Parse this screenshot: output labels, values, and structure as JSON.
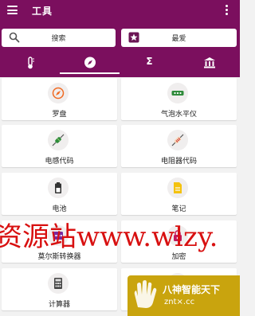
{
  "app": {
    "title": "工具"
  },
  "actions": {
    "search_label": "搜索",
    "favorites_label": "最爱"
  },
  "tabs": [
    {
      "name": "measure",
      "icon": "thermometer-icon",
      "selected": false
    },
    {
      "name": "compass",
      "icon": "compass-icon",
      "selected": true
    },
    {
      "name": "math",
      "icon": "sigma-icon",
      "selected": false,
      "glyph": "Σ"
    },
    {
      "name": "finance",
      "icon": "bank-icon",
      "selected": false
    }
  ],
  "tools": [
    {
      "label": "罗盘",
      "icon": "compass-icon"
    },
    {
      "label": "气泡水平仪",
      "icon": "bubble-level-icon"
    },
    {
      "label": "电感代码",
      "icon": "inductor-icon"
    },
    {
      "label": "电阻器代码",
      "icon": "resistor-icon"
    },
    {
      "label": "电池",
      "icon": "battery-icon"
    },
    {
      "label": "笔记",
      "icon": "note-icon"
    },
    {
      "label": "莫尔斯转换器",
      "icon": "morse-icon"
    },
    {
      "label": "加密",
      "icon": "lock-icon"
    },
    {
      "label": "计算器",
      "icon": "calculator-icon"
    },
    {
      "label": "",
      "icon": "unknown-icon"
    }
  ],
  "colors": {
    "primary": "#7b0f5e",
    "accent_orange": "#f06a22",
    "accent_green": "#2e8b3a",
    "accent_yellow": "#f4c20d",
    "watermark_red": "#d81010"
  },
  "watermark": {
    "text": "资源站www.wlzy.",
    "badge_line1": "八神智能天下",
    "badge_line2": "znt×.cc"
  }
}
